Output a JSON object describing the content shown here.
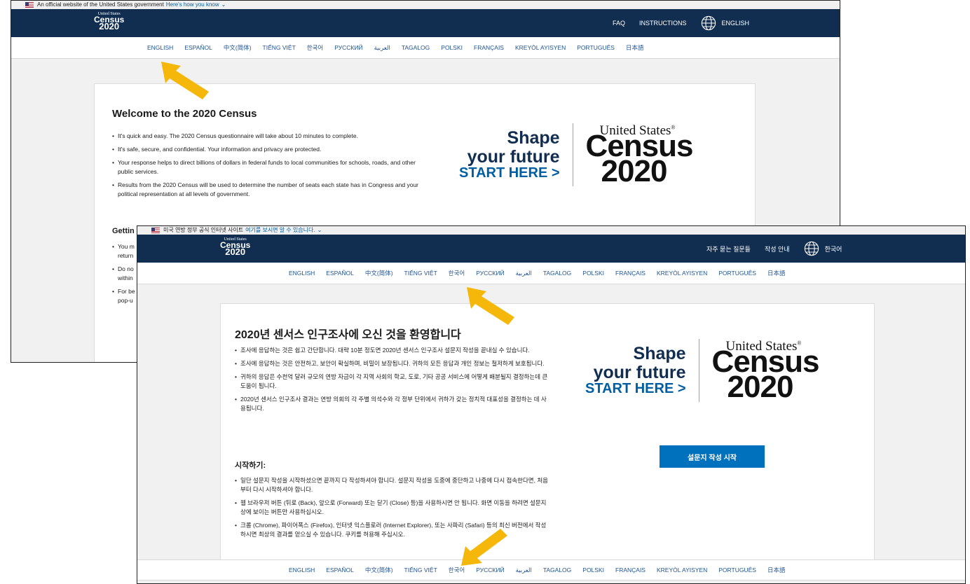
{
  "en": {
    "gov_banner": {
      "text": "An official website of the United States government",
      "link": "Here's how you know"
    },
    "logo": {
      "top": "United States",
      "mid": "Census",
      "year": "2020"
    },
    "nav": {
      "faq": "FAQ",
      "instructions": "INSTRUCTIONS",
      "language": "ENGLISH"
    },
    "languages": [
      "ENGLISH",
      "ESPAÑOL",
      "中文(简体)",
      "TIẾNG VIỆT",
      "한국어",
      "РУССКИЙ",
      "العربية",
      "TAGALOG",
      "POLSKI",
      "FRANÇAIS",
      "KREYÒL AYISYEN",
      "PORTUGUÊS",
      "日本語"
    ],
    "title": "Welcome to the 2020 Census",
    "bullets": [
      "It's quick and easy. The 2020 Census questionnaire will take about 10 minutes to complete.",
      "It's safe, secure, and confidential. Your information and privacy are protected.",
      "Your response helps to direct billions of dollars in federal funds to local communities for schools, roads, and other public services.",
      "Results from the 2020 Census will be used to determine the number of seats each state has in Congress and your political representation at all levels of government."
    ],
    "getting_started_partial": "Gettin",
    "partial_bullets": [
      "You m\nreturn",
      "Do no\nwithin",
      "For be\npop-u"
    ],
    "hero": {
      "line1": "Shape",
      "line2": "your future",
      "line3": "START HERE >",
      "brand_top": "United States",
      "brand_reg": "®",
      "brand_mid": "Census",
      "brand_year": "2020"
    }
  },
  "ko": {
    "gov_banner": {
      "text": "미국 연방 정부 공식 인터넷 사이트",
      "link": "여기를 보시면 알 수 있습니다."
    },
    "logo": {
      "top": "United States",
      "mid": "Census",
      "year": "2020"
    },
    "nav": {
      "faq": "자주 묻는 질문들",
      "instructions": "작성 안내",
      "language": "한국어"
    },
    "languages": [
      "ENGLISH",
      "ESPAÑOL",
      "中文(简体)",
      "TIẾNG VIỆT",
      "한국어",
      "РУССКИЙ",
      "العربية",
      "TAGALOG",
      "POLSKI",
      "FRANÇAIS",
      "KREYÒL AYISYEN",
      "PORTUGUÊS",
      "日本語"
    ],
    "title": "2020년 센서스 인구조사에 오신 것을 환영합니다",
    "bullets": [
      "조사에 응답하는 것은 쉽고 간단합니다. 대략 10분 정도면 2020년 센서스 인구조사 설문지 작성을 끝내실 수 있습니다.",
      "조사에 응답하는 것은 안전하고, 보안이 확실하며, 비밀이 보장됩니다. 귀하의 모든 응답과 개인 정보는 철저하게 보호됩니다.",
      "귀하의 응답은 수천억 달러 규모의 연방 자금이 각 지역 사회의 학교, 도로, 기타 공공 서비스에 어떻게 배분될지 결정하는데 큰 도움이 됩니다.",
      "2020년 센서스 인구조사 결과는 연방 의회의 각 주별 의석수와 각 정부 단위에서 귀하가 갖는 정치적 대표성을 결정하는 데 사용됩니다."
    ],
    "getting_started": "시작하기:",
    "gs_bullets": [
      "일단 설문지 작성을 시작하셨으면 끝까지 다 작성하셔야 합니다. 설문지 작성을 도중에 중단하고 나중에 다시 접속한다면, 처음부터 다시 시작하셔야 합니다.",
      "웹 브라우저 버튼 (뒤로 (Back), 앞으로 (Forward) 또는 닫기 (Close) 등)을 사용하시면 안 됩니다. 화면 이동을 하려면 설문지 상에 보이는 버튼만 사용하십시오.",
      "크롬 (Chrome), 파이어폭스 (Firefox), 인터넷 익스플로러 (Internet Explorer), 또는 사파리 (Safari) 등의 최신 버전에서 작성하시면 최상의 결과를 얻으실 수 있습니다. 쿠키를 허용해 주십시오."
    ],
    "start_button": "설문지 작성 시작",
    "hero": {
      "line1": "Shape",
      "line2": "your future",
      "line3": "START HERE >",
      "brand_top": "United States",
      "brand_reg": "®",
      "brand_mid": "Census",
      "brand_year": "2020"
    },
    "footer_languages": [
      "ENGLISH",
      "ESPAÑOL",
      "中文(简体)",
      "TIẾNG VIỆT",
      "한국어",
      "РУССКИЙ",
      "العربية",
      "TAGALOG",
      "POLSKI",
      "FRANÇAIS",
      "KREYÒL AYISYEN",
      "PORTUGUÊS",
      "日本語"
    ]
  },
  "colors": {
    "header": "#112e51",
    "link": "#205493",
    "arrow": "#f5b80a",
    "button": "#0071bc"
  }
}
